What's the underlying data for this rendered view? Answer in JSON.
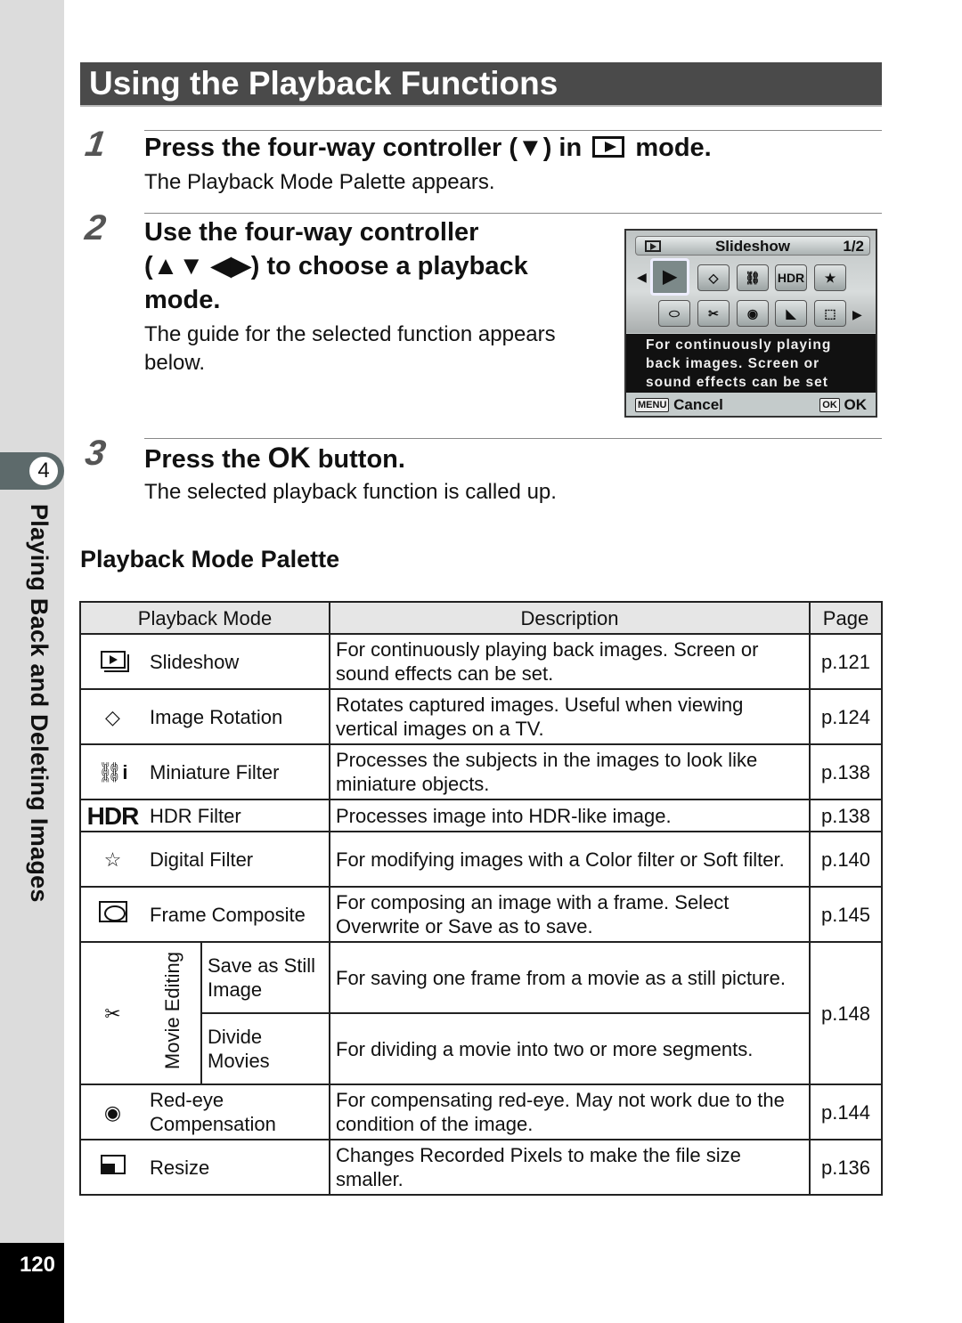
{
  "page": {
    "title": "Using the Playback Functions",
    "chapter_number": "4",
    "chapter_title": "Playing Back and Deleting Images",
    "page_number": "120"
  },
  "steps": [
    {
      "number": "1",
      "heading_pre": "Press the four-way controller (▼) in",
      "heading_icon": "playback-mode-icon",
      "heading_post": "mode.",
      "body": "The Playback Mode Palette appears."
    },
    {
      "number": "2",
      "heading_line1": "Use the four-way controller",
      "heading_line2": "(▲▼ ◀▶) to choose a playback",
      "heading_line3": "mode.",
      "body_line1": "The guide for the selected function appears",
      "body_line2": "below."
    },
    {
      "number": "3",
      "heading_pre": "Press the",
      "heading_key": "OK",
      "heading_post": "button.",
      "body": "The selected playback function is called up."
    }
  ],
  "camera_screen": {
    "mode_title": "Slideshow",
    "page_indicator": "1/2",
    "icons_row1": [
      {
        "name": "slideshow-icon",
        "glyph": "▶",
        "selected": true
      },
      {
        "name": "image-rotation-icon",
        "glyph": "◇"
      },
      {
        "name": "miniature-filter-icon",
        "glyph": "🚗"
      },
      {
        "name": "hdr-filter-icon",
        "glyph": "HDR"
      },
      {
        "name": "digital-filter-icon",
        "glyph": "★"
      }
    ],
    "icons_row2": [
      {
        "name": "frame-composite-icon",
        "glyph": "⬭"
      },
      {
        "name": "movie-editing-icon",
        "glyph": "✂"
      },
      {
        "name": "red-eye-icon",
        "glyph": "◉"
      },
      {
        "name": "resize-icon",
        "glyph": "◣"
      },
      {
        "name": "crop-icon",
        "glyph": "⬚"
      }
    ],
    "guide_text": [
      "For continuously playing",
      "back images. Screen or",
      "sound effects can be set"
    ],
    "menu_key": "MENU",
    "cancel_label": "Cancel",
    "ok_key": "OK",
    "ok_label": "OK",
    "left_arrow": "◀",
    "right_arrow": "▶"
  },
  "palette": {
    "heading": "Playback Mode Palette",
    "columns": [
      "Playback Mode",
      "Description",
      "Page"
    ],
    "rows": [
      {
        "icon": "slideshow-icon",
        "mode": "Slideshow",
        "description": "For continuously playing back images. Screen or sound effects can be set.",
        "page": "p.121"
      },
      {
        "icon": "image-rotation-icon",
        "icon_glyph": "◇",
        "mode": "Image Rotation",
        "description": "Rotates captured images. Useful when viewing vertical images on a TV.",
        "page": "p.124"
      },
      {
        "icon": "miniature-filter-icon",
        "icon_glyph": "⛟ℹ",
        "mode": "Miniature Filter",
        "description": "Processes the subjects in the images to look like miniature objects.",
        "page": "p.138"
      },
      {
        "icon": "hdr-filter-icon",
        "icon_glyph": "HDR",
        "mode": "HDR Filter",
        "description": "Processes image into HDR-like image.",
        "page": "p.138"
      },
      {
        "icon": "digital-filter-icon",
        "icon_glyph": "☆",
        "mode": "Digital Filter",
        "description": "For modifying images with a Color filter or Soft filter.",
        "page": "p.140"
      },
      {
        "icon": "frame-composite-icon",
        "mode": "Frame Composite",
        "description": "For composing an image with a frame. Select Overwrite or Save as to save.",
        "page": "p.145"
      },
      {
        "icon": "red-eye-icon",
        "icon_glyph": "◉",
        "mode": "Red-eye Compensation",
        "description": "For compensating red-eye. May not work due to the condition of the image.",
        "page": "p.144"
      },
      {
        "icon": "resize-icon",
        "mode": "Resize",
        "description": "Changes Recorded Pixels to make the file size smaller.",
        "page": "p.136"
      }
    ],
    "movie_editing": {
      "group_label": "Movie Editing",
      "icon_glyph": "✂",
      "page": "p.148",
      "subrows": [
        {
          "mode": "Save as Still Image",
          "description": "For saving one frame from a movie as a still picture."
        },
        {
          "mode": "Divide Movies",
          "description": "For dividing a movie into two or more segments."
        }
      ]
    }
  }
}
